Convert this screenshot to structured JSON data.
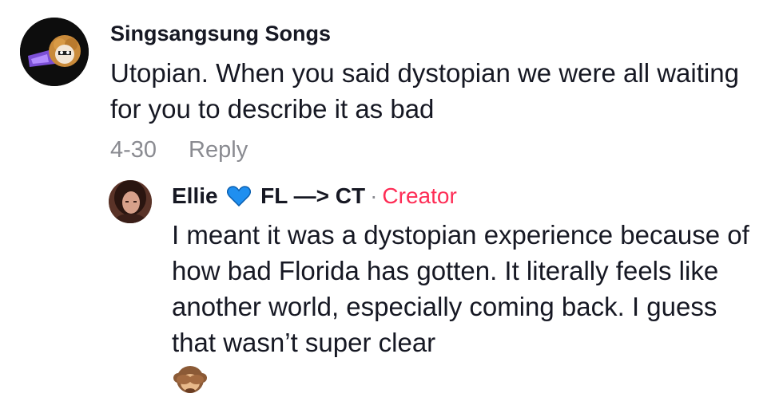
{
  "comment": {
    "username": "Singsangsung Songs",
    "text": "Utopian. When you said dystopian we were all waiting for you to describe it as bad",
    "date": "4-30",
    "reply_label": "Reply"
  },
  "reply": {
    "username": "Ellie",
    "username_suffix": "FL —> CT",
    "separator": "·",
    "creator_badge": "Creator",
    "text": "I meant it was a dystopian experience because of how bad Florida has gotten. It literally feels like another world, especially coming back. I guess that wasn’t super clear",
    "heart_icon": "blue-heart-icon",
    "emoji_icon": "see-no-evil-monkey-icon"
  },
  "colors": {
    "text": "#161823",
    "muted": "#8a8b91",
    "creator": "#fe2c55",
    "heart": "#1f8ff0"
  }
}
